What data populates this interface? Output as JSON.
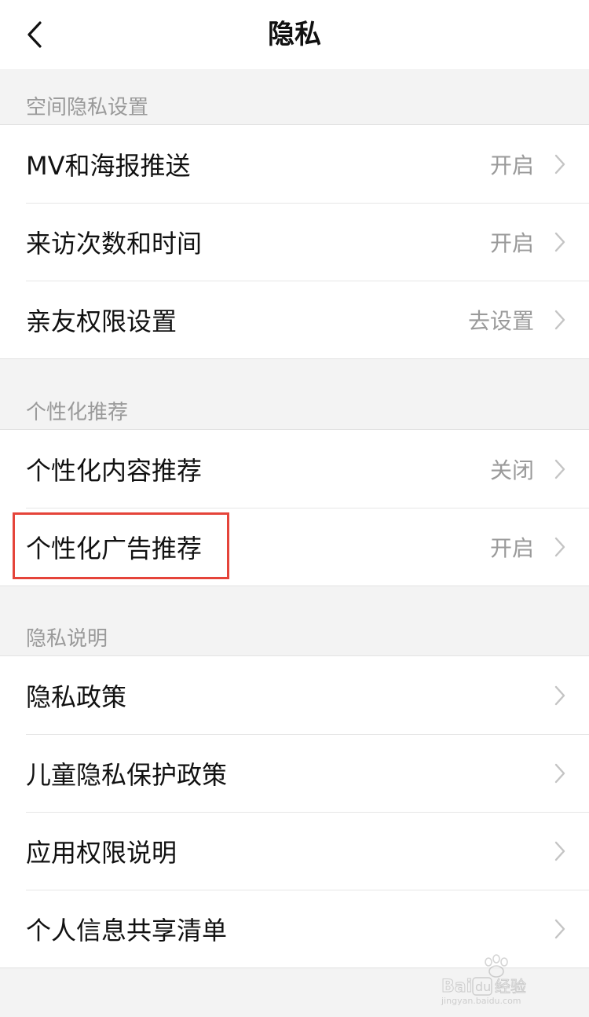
{
  "header": {
    "title": "隐私",
    "back_icon": "chevron-left-icon"
  },
  "sections": [
    {
      "header": "空间隐私设置",
      "items": [
        {
          "label": "MV和海报推送",
          "value": "开启"
        },
        {
          "label": "来访次数和时间",
          "value": "开启"
        },
        {
          "label": "亲友权限设置",
          "value": "去设置"
        }
      ]
    },
    {
      "header": "个性化推荐",
      "items": [
        {
          "label": "个性化内容推荐",
          "value": "关闭"
        },
        {
          "label": "个性化广告推荐",
          "value": "开启"
        }
      ]
    },
    {
      "header": "隐私说明",
      "items": [
        {
          "label": "隐私政策",
          "value": ""
        },
        {
          "label": "儿童隐私保护政策",
          "value": ""
        },
        {
          "label": "应用权限说明",
          "value": ""
        },
        {
          "label": "个人信息共享清单",
          "value": ""
        }
      ]
    }
  ],
  "annotation": {
    "highlight_color": "#e5443a"
  },
  "watermark": {
    "text": "Baidu经验",
    "subtext": "jingyan.baidu.com"
  },
  "colors": {
    "background": "#f3f3f3",
    "section_header": "#9a9a9a",
    "value_text": "#9a9a9a",
    "chevron": "#c4c4c4"
  }
}
